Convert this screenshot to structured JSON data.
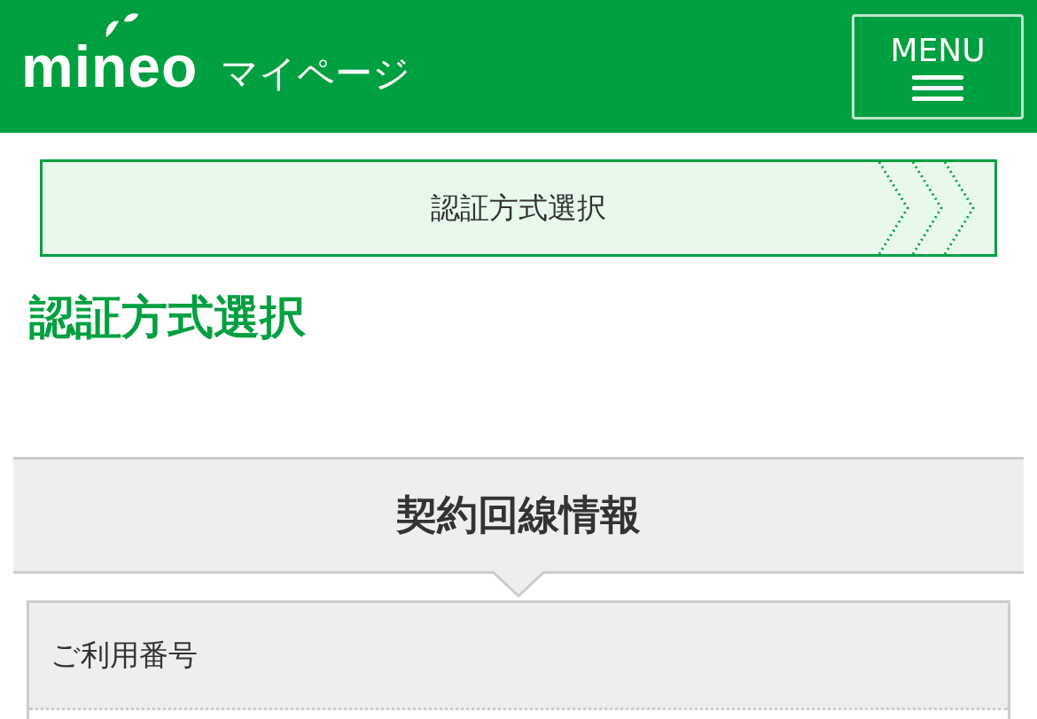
{
  "header": {
    "logo": "mineo",
    "subtitle": "マイページ",
    "menu_button": {
      "label": "MENU"
    }
  },
  "step": {
    "label": "認証方式選択"
  },
  "page_title": "認証方式選択",
  "section": {
    "title": "契約回線情報",
    "rows": [
      {
        "label": "ご利用番号"
      }
    ]
  }
}
